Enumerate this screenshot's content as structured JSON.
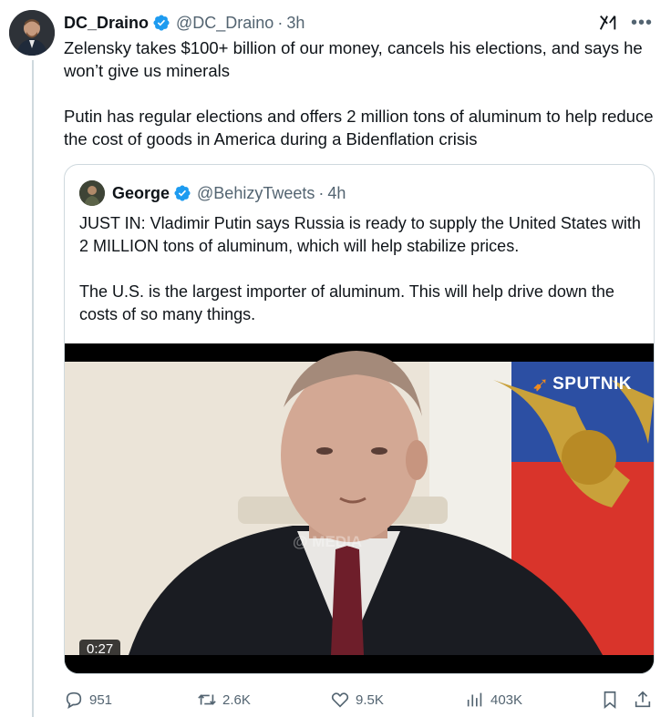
{
  "author": {
    "name": "DC_Draino",
    "handle": "@DC_Draino",
    "time": "3h"
  },
  "tweet": {
    "paragraphs": [
      "Zelensky takes $100+ billion of our money, cancels his elections, and says he won’t give us minerals",
      "Putin has regular elections and offers 2 million tons of aluminum to help reduce the cost of goods in America during a Bidenflation crisis"
    ]
  },
  "quote": {
    "name": "George",
    "handle": "@BehizyTweets",
    "time": "4h",
    "paragraphs": [
      "JUST IN: Vladimir Putin says Russia is ready to supply the United States with 2 MILLION tons of aluminum, which will help stabilize prices.",
      "The U.S. is the largest importer of aluminum. This will help drive down the costs of so many things."
    ],
    "video": {
      "duration": "0:27",
      "logo_text": "SPUTNIK",
      "watermark": "@ MEDIA"
    }
  },
  "actions": {
    "replies": "951",
    "reposts": "2.6K",
    "likes": "9.5K",
    "views": "403K"
  },
  "colors": {
    "verified": "#1d9bf0",
    "secondary_text": "#536471",
    "border": "#cfd9de"
  },
  "icons": {
    "verified": "verified-badge-icon",
    "grok": "grok-icon",
    "more": "more-dots-icon",
    "reply": "reply-icon",
    "repost": "repost-icon",
    "like": "heart-icon",
    "views": "views-chart-icon",
    "bookmark": "bookmark-icon",
    "share": "share-icon"
  }
}
